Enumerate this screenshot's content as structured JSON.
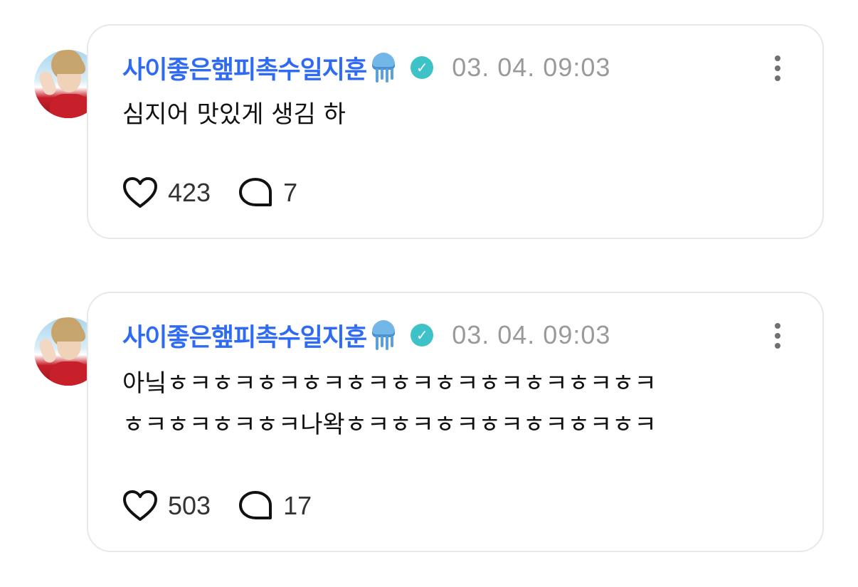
{
  "posts": [
    {
      "username": "사이좋은햎피촉수일지훈",
      "emoji_icon": "jellyfish-emoji",
      "verified_icon": "verified-check-icon",
      "timestamp": "03. 04. 09:03",
      "text": "심지어 맛있게 생김 하",
      "likes": "423",
      "comments": "7"
    },
    {
      "username": "사이좋은햎피촉수일지훈",
      "emoji_icon": "jellyfish-emoji",
      "verified_icon": "verified-check-icon",
      "timestamp": "03. 04. 09:03",
      "text": "아닠ㅎㅋㅎㅋㅎㅋㅎㅋㅎㅋㅎㅋㅎㅋㅎㅋㅎㅋㅎㅋㅎㅋ\nㅎㅋㅎㅋㅎㅋㅎㅋ나왁ㅎㅋㅎㅋㅎㅋㅎㅋㅎㅋㅎㅋㅎㅋ",
      "likes": "503",
      "comments": "17"
    }
  ],
  "colors": {
    "username": "#2f6bf2",
    "verified": "#3dc3c7",
    "timestamp": "#9a9a9a",
    "border": "#e8e8e8"
  }
}
